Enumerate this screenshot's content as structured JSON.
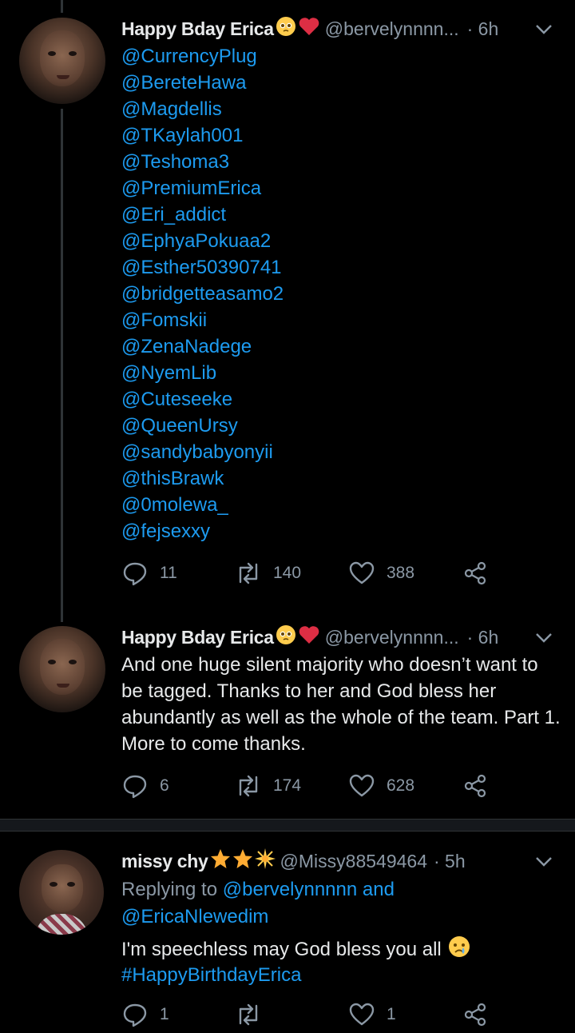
{
  "tweets": [
    {
      "name": "Happy Bday Erica",
      "handle": "@bervelynnnn...",
      "time": "· 6h",
      "mentions": [
        "@CurrencyPlug",
        "@BereteHawa",
        "@Magdellis",
        "@TKaylah001",
        "@Teshoma3",
        "@PremiumErica",
        "@Eri_addict",
        "@EphyaPokuaa2",
        "@Esther50390741",
        "@bridgetteasamo2",
        "@Fomskii",
        "@ZenaNadege",
        "@NyemLib",
        "@Cuteseeke",
        "@QueenUrsy",
        "@sandybabyonyii",
        "@thisBrawk",
        "@0molewa_",
        "@fejsexxy"
      ],
      "replies": "11",
      "retweets": "140",
      "likes": "388"
    },
    {
      "name": "Happy Bday Erica",
      "handle": "@bervelynnnn...",
      "time": "· 6h",
      "text": "And one huge silent majority who doesn’t want to be tagged. Thanks to her and God bless her abundantly as well as the whole of the team. Part 1. More to come thanks.",
      "replies": "6",
      "retweets": "174",
      "likes": "628"
    },
    {
      "name": "missy chy",
      "handle": "@Missy88549464",
      "time": "· 5h",
      "replying_prefix": "Replying to",
      "replying_to_1": "@bervelynnnnn",
      "replying_and": "and",
      "replying_to_2": "@EricaNlewedim",
      "text": "I'm speechless may God bless you all",
      "hashtag": "#HappyBirthdayErica",
      "replies": "1",
      "likes": "1"
    }
  ],
  "colors": {
    "background": "#000000",
    "link": "#1d9bf0",
    "muted": "#8b98a5",
    "text": "#e7e9ea",
    "heart": "#e0245e",
    "star": "#f5c518"
  },
  "icons": [
    "reply-icon",
    "retweet-icon",
    "like-icon",
    "share-icon",
    "chevron-down-icon",
    "pleading-face-emoji",
    "red-heart-emoji",
    "star-emoji",
    "sparkle-star-emoji",
    "crying-face-emoji"
  ]
}
